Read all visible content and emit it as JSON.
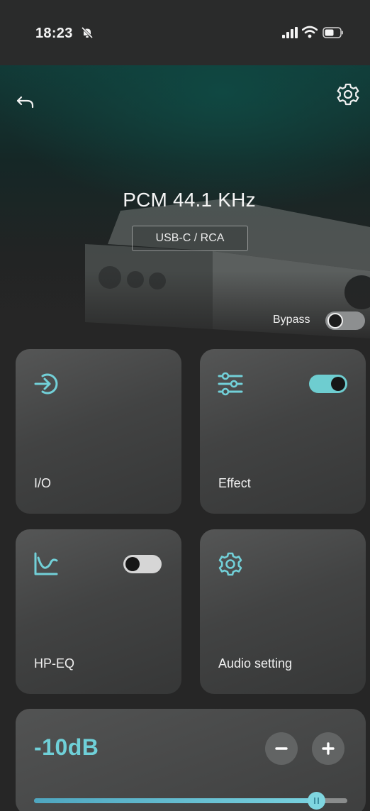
{
  "status_bar": {
    "time": "18:23"
  },
  "header": {
    "format": "PCM 44.1 KHz",
    "io_badge": "USB-C / RCA"
  },
  "bypass": {
    "label": "Bypass",
    "enabled": false
  },
  "cards": {
    "io": {
      "label": "I/O",
      "icon": "input-arrow-icon"
    },
    "effect": {
      "label": "Effect",
      "icon": "sliders-icon",
      "enabled": true
    },
    "hpeq": {
      "label": "HP-EQ",
      "icon": "eq-curve-icon",
      "enabled": false
    },
    "audio": {
      "label": "Audio setting",
      "icon": "gear-icon"
    }
  },
  "volume": {
    "value": "-10dB",
    "level_fraction": 0.9
  },
  "colors": {
    "accent": "#6ecdd0",
    "card": "#474848",
    "background": "#262626"
  }
}
